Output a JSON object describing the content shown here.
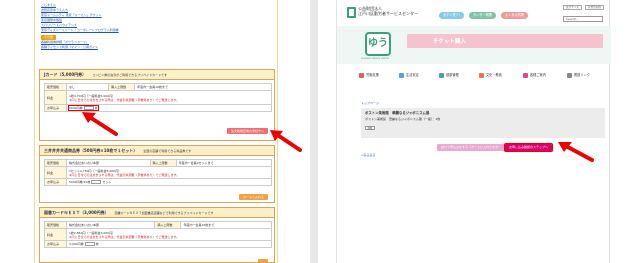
{
  "left": {
    "links": [
      "ごしまえん",
      "志賀高原ゆうえんち",
      "東京ドームシティ 東京「ルーミン」チケット",
      "東京国際水族館",
      "スパリゾートハワイアンズ",
      "東京ディズニーリゾート・コーポレートプログラム利用券"
    ],
    "badge": "その他",
    "links2": [
      "各種利用券詳細「ボウランカード」",
      "各種ライセンス利用（マイン・公報ガイド"
    ],
    "sections": [
      {
        "title": "Jカード（5,000円券）",
        "note": "コンビニ券の決済がご利用できるプリペイドカードです",
        "rows": [
          {
            "h": "販売価格",
            "v": "なし",
            "h2": "購入上限数",
            "v2": "年度内一会員10枚まで"
          },
          {
            "h": "料金",
            "v": "1枚4,700円（一般料金5,000円）",
            "red": "※同じ日付での注文をされる際は、代金引換頂戴（手数料あり）でご発送します。"
          },
          {
            "h": "お申込み",
            "v": "5000円券",
            "unit": "枚"
          }
        ],
        "button": "注文数確定後の手続きへ",
        "button_orange": false
      },
      {
        "title": "三井井井共通商品券（500円券×10枚で１セット）",
        "note": "全国の店舗で利用できる商品券です",
        "rows": [
          {
            "h": "販売価格",
            "v": "株式会社あいおい本部",
            "h2": "購入上限数",
            "v2": "年度内一会員2セットまで"
          },
          {
            "h": "料金",
            "v": "1セット4,750円（一般料金5,000円）",
            "red": "※同じ日付での注文をされる際は、代金引換頂戴（手数料あり）でご発送します。"
          },
          {
            "h": "お申込み",
            "v": "5000円券/10枚",
            "unit": "セット"
          }
        ],
        "button": "カートへ入れる",
        "button_orange": true
      },
      {
        "title": "図書カードＮＥＸＴ（3,000円券）",
        "note": "図書カードＮＥＸＴ加盟書店店舗などで利用できるプリペイドカードです",
        "rows": [
          {
            "h": "販売価格",
            "v": "株式会社あいおい本部",
            "h2": "購入上限数",
            "v2": "年度内一会員10枚まで"
          },
          {
            "h": "料金",
            "v": "1枚2,850円（一般料金3,000円）",
            "red": "※同じ日付での注文をされる際は、代金引換頂戴（手数料あり）でご発送します。"
          },
          {
            "h": "お申込み",
            "v": "3,000円券",
            "unit": "枚"
          }
        ],
        "button": "",
        "button_orange": true
      }
    ]
  },
  "right": {
    "org_line1": "公益財団法人",
    "org_line2": "江戸川区勤労者サービスセンター",
    "pill1": "今すぐ見て!",
    "pill2": "カンター概要",
    "pill3": "よくある質問",
    "util1": "文字サイズ",
    "util2": "背景色切替",
    "search_placeholder": "Search...",
    "hero_title": "チケット購入",
    "logo_text": "ゆう",
    "logo_sub": "WORKERS SERVICE CENTER",
    "nav": [
      "労働支援",
      "生活安定",
      "健康管理",
      "文化・教養",
      "各種ご案内",
      "関連リンク"
    ],
    "breadcrumb": "トップページ",
    "ticket_title": "ボストン美術館　華麗なるジャポニスム展",
    "ticket_row": "ボストン美術館　華麗なるジャポニスム展（一般）：1枚",
    "ticket_btn": "削除",
    "back_btn": "続けて申込みをする（カートに入れたまま）",
    "next_btn": "お申し込み確認のステップへ",
    "return_link": "<戻る戻る"
  },
  "colors": {
    "accent_red": "#e00000",
    "brand_green": "#3aa07a",
    "pink": "#f4c3cf",
    "magenta": "#d6006e"
  }
}
